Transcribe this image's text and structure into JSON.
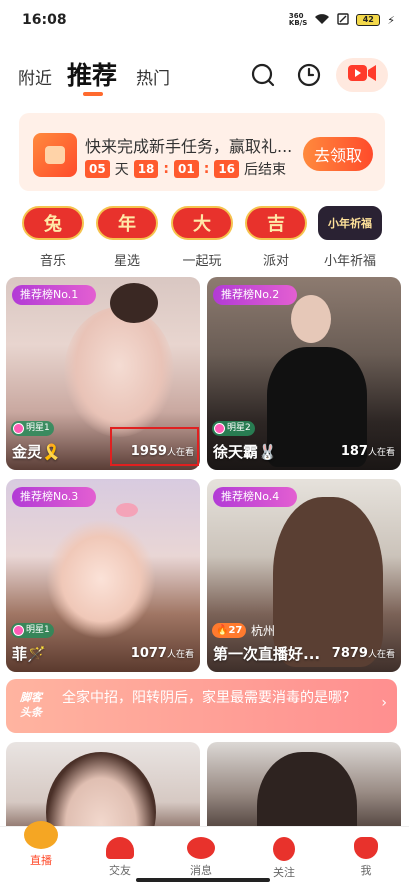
{
  "status_bar": {
    "time": "16:08",
    "network": "360\nKB/S",
    "battery": "42"
  },
  "header": {
    "tabs": [
      {
        "label": "附近"
      },
      {
        "label": "推荐"
      },
      {
        "label": "热门"
      }
    ],
    "icons": [
      "search-icon",
      "history-icon",
      "live-camera-icon"
    ]
  },
  "banner": {
    "title": "快来完成新手任务，赢取礼...",
    "countdown": {
      "days": "05",
      "day_unit": "天",
      "hours": "18",
      "minutes": "01",
      "seconds": "16",
      "suffix": "后结束"
    },
    "button": "去领取"
  },
  "categories": [
    {
      "badge": "兔",
      "label": "音乐"
    },
    {
      "badge": "年",
      "label": "星选"
    },
    {
      "badge": "大",
      "label": "一起玩"
    },
    {
      "badge": "吉",
      "label": "派对"
    },
    {
      "badge": "小年祈福",
      "label": "小年祈福"
    }
  ],
  "streams": [
    {
      "rank": "推荐榜No.1",
      "level": "明星1",
      "name": "金灵🎗️",
      "viewers": "1959",
      "viewers_unit": "人在看"
    },
    {
      "rank": "推荐榜No.2",
      "level": "明星2",
      "name": "徐天霸🐰",
      "viewers": "187",
      "viewers_unit": "人在看"
    },
    {
      "rank": "推荐榜No.3",
      "level": "明星1",
      "name": "菲🪄",
      "viewers": "1077",
      "viewers_unit": "人在看"
    },
    {
      "rank": "推荐榜No.4",
      "hot": "27",
      "city": "杭州",
      "name": "第一次直播好...",
      "viewers": "7879",
      "viewers_unit": "人在看"
    }
  ],
  "news": {
    "tag": "脚客\n头条",
    "text": "全家中招，阳转阴后，家里最需要消毒的是哪？"
  },
  "bottom_nav": [
    {
      "label": "直播"
    },
    {
      "label": "交友"
    },
    {
      "label": "消息"
    },
    {
      "label": "关注"
    },
    {
      "label": "我"
    }
  ],
  "colors": {
    "accent": "#ff4b2b",
    "rank_badge": "#c845d8",
    "banner_bg": "#fff0e8"
  }
}
